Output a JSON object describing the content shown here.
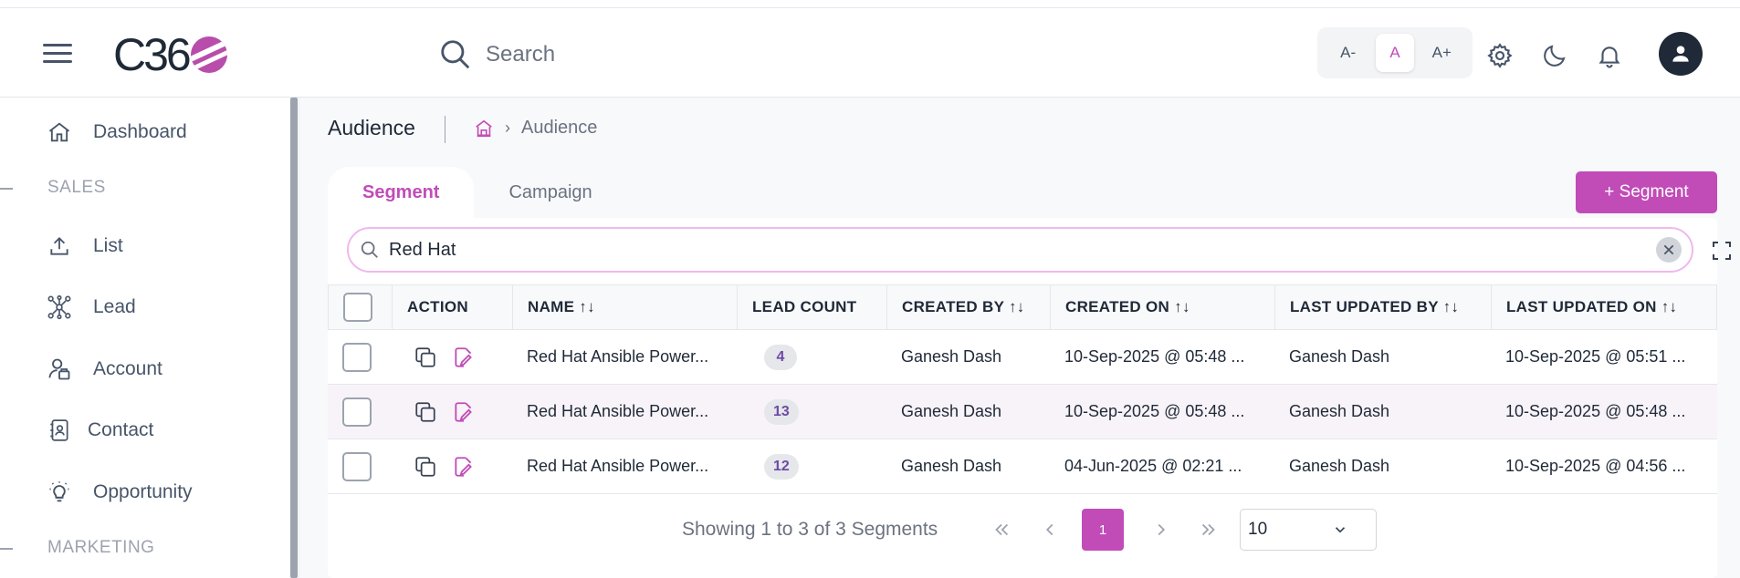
{
  "header": {
    "logo_text": "C36",
    "search_placeholder": "Search",
    "font_controls": [
      "A-",
      "A",
      "A+"
    ]
  },
  "sidebar": {
    "items": [
      {
        "label": "Dashboard",
        "icon": "home-icon"
      },
      {
        "section": "SALES"
      },
      {
        "label": "List",
        "icon": "upload-icon"
      },
      {
        "label": "Lead",
        "icon": "network-icon"
      },
      {
        "label": "Account",
        "icon": "account-icon"
      },
      {
        "label": "Contact",
        "icon": "contact-book-icon"
      },
      {
        "label": "Opportunity",
        "icon": "lightbulb-icon"
      },
      {
        "section": "MARKETING"
      }
    ]
  },
  "page": {
    "title": "Audience",
    "breadcrumb_current": "Audience",
    "tabs": [
      "Segment",
      "Campaign"
    ],
    "active_tab": "Segment",
    "add_button": "+ Segment",
    "search_value": "Red Hat"
  },
  "table": {
    "columns": [
      "ACTION",
      "NAME ↑↓",
      "LEAD COUNT",
      "CREATED BY ↑↓",
      "CREATED ON ↑↓",
      "LAST UPDATED BY ↑↓",
      "LAST UPDATED ON ↑↓"
    ],
    "rows": [
      {
        "name": "Red Hat Ansible Power...",
        "lead_count": "4",
        "created_by": "Ganesh Dash",
        "created_on": "10-Sep-2025 @ 05:48 ...",
        "updated_by": "Ganesh Dash",
        "updated_on": "10-Sep-2025 @ 05:51 ..."
      },
      {
        "name": "Red Hat Ansible Power...",
        "lead_count": "13",
        "created_by": "Ganesh Dash",
        "created_on": "10-Sep-2025 @ 05:48 ...",
        "updated_by": "Ganesh Dash",
        "updated_on": "10-Sep-2025 @ 05:48 ..."
      },
      {
        "name": "Red Hat Ansible Power...",
        "lead_count": "12",
        "created_by": "Ganesh Dash",
        "created_on": "04-Jun-2025 @ 02:21 ...",
        "updated_by": "Ganesh Dash",
        "updated_on": "10-Sep-2025 @ 04:56 ..."
      }
    ]
  },
  "pagination": {
    "info": "Showing 1 to 3 of 3 Segments",
    "first": "<<",
    "prev": "<",
    "current_page": "1",
    "next": ">",
    "last": ">>",
    "page_size": "10"
  },
  "colors": {
    "accent": "#c14cb8",
    "row_highlight": "#f8f3f9"
  }
}
